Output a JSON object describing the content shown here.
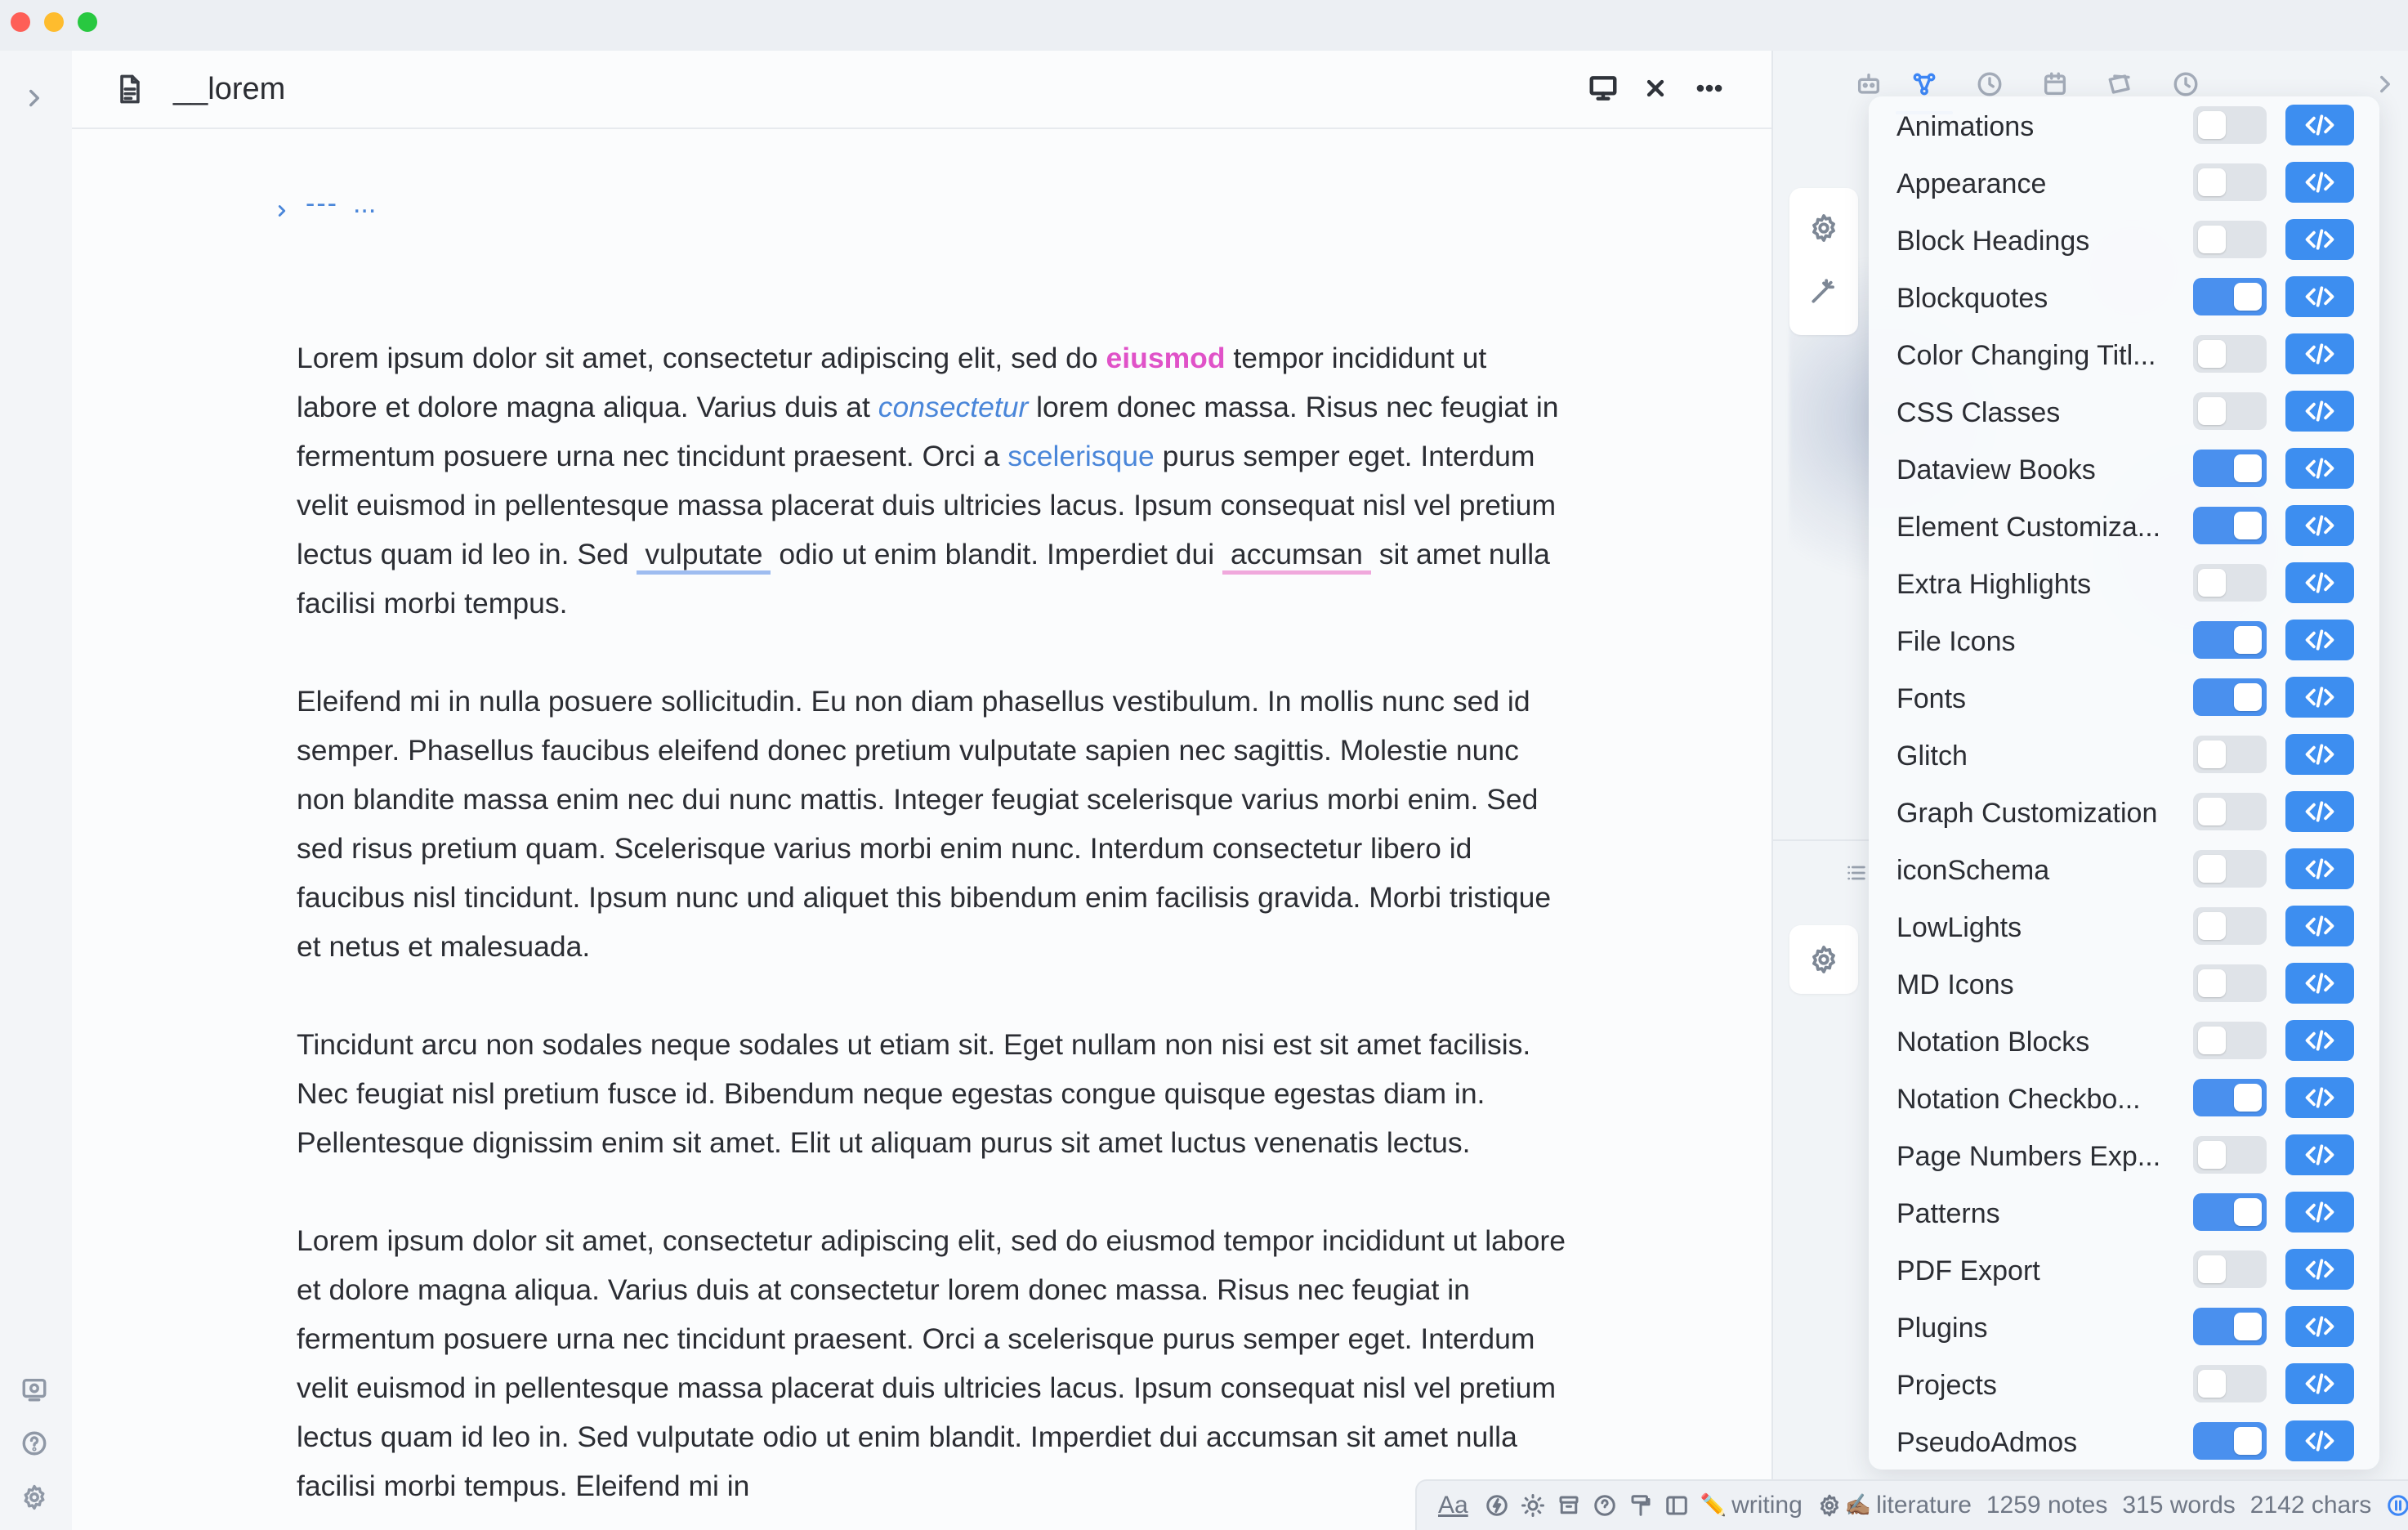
{
  "colors": {
    "accent": "#3d8ef0",
    "highlight_pink": "#e052c8",
    "link_blue": "#4a86d9"
  },
  "editor": {
    "tab_title": "__lorem",
    "frontmatter": {
      "dashes": "---",
      "ellipsis": "..."
    },
    "paragraphs": {
      "p1": {
        "a": "Lorem ipsum dolor sit amet, consectetur adipiscing elit, sed do ",
        "b": "eiusmod",
        "c": " tempor incididunt ut labore et dolore magna aliqua. Varius duis at ",
        "d": "consectetur",
        "e": " lorem donec massa. Risus nec feugiat in fermentum posuere urna nec tincidunt praesent. Orci a ",
        "f": "scelerisque",
        "g": " purus semper eget. Interdum velit euismod in pellentesque massa placerat duis ultricies lacus. Ipsum consequat nisl vel pretium lectus quam id leo in. Sed ",
        "h": "vulputate",
        "i": " odio ut enim blandit. Imperdiet dui ",
        "j": "accumsan",
        "k": " sit amet nulla facilisi morbi tempus."
      },
      "p2": "Eleifend mi in nulla posuere sollicitudin. Eu non diam phasellus vestibulum. In mollis nunc sed id semper. Phasellus faucibus eleifend donec pretium vulputate sapien nec sagittis. Molestie nunc non blandite massa enim nec dui nunc mattis. Integer feugiat scelerisque varius morbi enim. Sed sed risus pretium quam. Scelerisque varius morbi enim nunc. Interdum consectetur libero id faucibus nisl tincidunt. Ipsum nunc und aliquet this bibendum enim facilisis gravida. Morbi tristique et netus et malesuada.",
      "p3": "Tincidunt arcu non sodales neque sodales ut etiam sit. Eget nullam non nisi est sit amet facilisis. Nec feugiat nisl pretium fusce id. Bibendum neque egestas congue quisque egestas diam in. Pellentesque dignissim enim sit amet. Elit ut aliquam purus sit amet luctus venenatis lectus.",
      "p4": "Lorem ipsum dolor sit amet, consectetur adipiscing elit, sed do eiusmod tempor incididunt ut labore et dolore magna aliqua. Varius duis at consectetur lorem donec massa. Risus nec feugiat in fermentum posuere urna nec tincidunt praesent. Orci a scelerisque purus semper eget. Interdum velit euismod in pellentesque massa placerat duis ultricies lacus. Ipsum consequat nisl vel pretium lectus quam id leo in. Sed vulputate odio ut enim blandit. Imperdiet dui accumsan sit amet nulla facilisi morbi tempus. Eleifend mi in"
    }
  },
  "snippets": [
    {
      "label": "Animations",
      "enabled": false
    },
    {
      "label": "Appearance",
      "enabled": false
    },
    {
      "label": "Block Headings",
      "enabled": false
    },
    {
      "label": "Blockquotes",
      "enabled": true
    },
    {
      "label": "Color Changing Titl...",
      "enabled": false
    },
    {
      "label": "CSS Classes",
      "enabled": false
    },
    {
      "label": "Dataview Books",
      "enabled": true
    },
    {
      "label": "Element Customiza...",
      "enabled": true
    },
    {
      "label": "Extra Highlights",
      "enabled": false
    },
    {
      "label": "File Icons",
      "enabled": true
    },
    {
      "label": "Fonts",
      "enabled": true
    },
    {
      "label": "Glitch",
      "enabled": false
    },
    {
      "label": "Graph Customization",
      "enabled": false
    },
    {
      "label": "iconSchema",
      "enabled": false
    },
    {
      "label": "LowLights",
      "enabled": false
    },
    {
      "label": "MD Icons",
      "enabled": false
    },
    {
      "label": "Notation Blocks",
      "enabled": false
    },
    {
      "label": "Notation Checkbo...",
      "enabled": true
    },
    {
      "label": "Page Numbers Exp...",
      "enabled": false
    },
    {
      "label": "Patterns",
      "enabled": true
    },
    {
      "label": "PDF Export",
      "enabled": false
    },
    {
      "label": "Plugins",
      "enabled": true
    },
    {
      "label": "Projects",
      "enabled": false
    },
    {
      "label": "PseudoAdmos",
      "enabled": true
    }
  ],
  "statusbar": {
    "font_label": "Aa",
    "mode1": "writing",
    "mode2": "literature",
    "notes": "1259 notes",
    "words": "315 words",
    "chars": "2142 chars",
    "emoji_writing": "✏️",
    "emoji_literature": "✍🏽"
  }
}
